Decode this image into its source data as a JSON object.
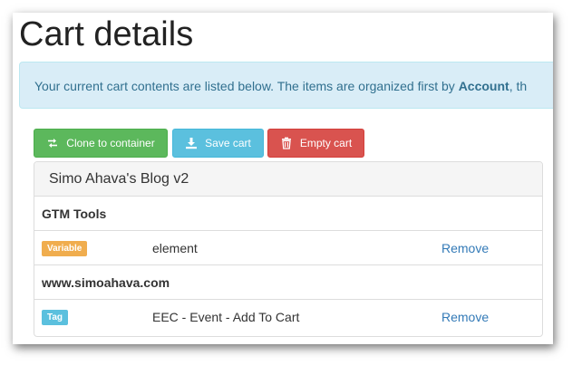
{
  "page": {
    "title": "Cart details",
    "alert": {
      "text_before": "Your current cart contents are listed below. The items are organized first by ",
      "bold": "Account",
      "text_after": ", th"
    }
  },
  "toolbar": {
    "clone_label": "Clone to container",
    "save_label": "Save cart",
    "empty_label": "Empty cart"
  },
  "colors": {
    "success": "#5cb85c",
    "info": "#5bc0de",
    "danger": "#d9534f",
    "warning": "#f0ad4e",
    "link": "#337ab7"
  },
  "cart": {
    "account": "Simo Ahava's Blog v2",
    "sections": [
      {
        "container": "GTM Tools",
        "item": {
          "type": "Variable",
          "name": "element",
          "action": "Remove"
        }
      },
      {
        "container": "www.simoahava.com",
        "item": {
          "type": "Tag",
          "name": "EEC - Event - Add To Cart",
          "action": "Remove"
        }
      }
    ]
  }
}
